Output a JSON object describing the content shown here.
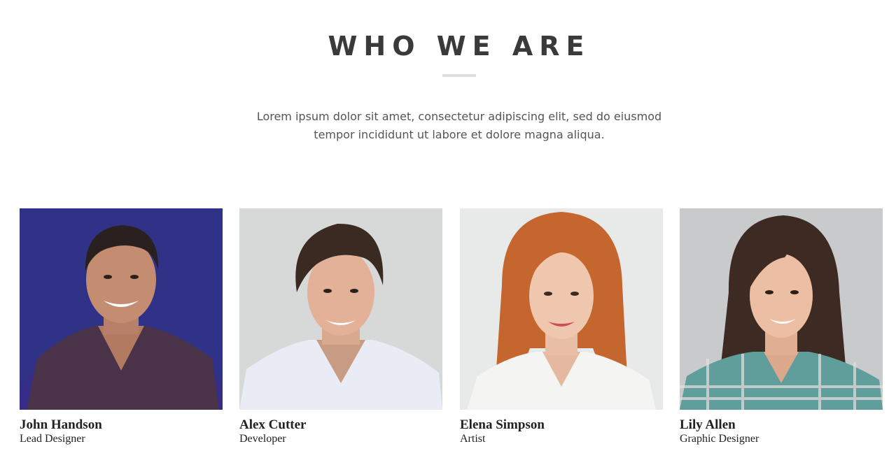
{
  "section": {
    "title": "WHO WE ARE",
    "intro": "Lorem ipsum dolor sit amet, consectetur adipiscing elit, sed do eiusmod tempor incididunt ut labore et dolore magna aliqua."
  },
  "team": [
    {
      "name": "John Handson",
      "role": "Lead Designer"
    },
    {
      "name": "Alex Cutter",
      "role": "Developer"
    },
    {
      "name": "Elena Simpson",
      "role": "Artist"
    },
    {
      "name": "Lily Allen",
      "role": "Graphic Designer"
    }
  ],
  "colors": {
    "heading": "#3a3a3a",
    "divider": "#dcdcdc",
    "body_text": "#555555",
    "name_text": "#222222"
  }
}
